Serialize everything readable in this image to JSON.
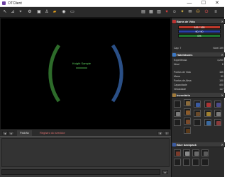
{
  "window": {
    "title": "OTClient",
    "min_glyph": "—",
    "max_glyph": "☐",
    "close_glyph": "✕"
  },
  "toolbar_left": [
    {
      "name": "arrow-icon",
      "glyph": "↖"
    },
    {
      "name": "logout-icon",
      "glyph": "⊿"
    },
    {
      "name": "hotkeys-icon",
      "glyph": "⌖"
    },
    {
      "name": "options-icon",
      "glyph": "⚙"
    },
    {
      "name": "minimap-icon",
      "glyph": "▣"
    },
    {
      "name": "outfit-icon",
      "glyph": "♙"
    },
    {
      "name": "folder-icon",
      "glyph": "▰"
    },
    {
      "name": "record-icon",
      "glyph": "◉"
    },
    {
      "name": "screenshot-icon",
      "glyph": "▭"
    }
  ],
  "toolbar_right": [
    {
      "name": "battle-list-icon",
      "glyph": "▤"
    },
    {
      "name": "skills-icon",
      "glyph": "▦"
    },
    {
      "name": "inventory-icon",
      "glyph": "▥"
    },
    {
      "name": "health-icon",
      "glyph": "♥"
    },
    {
      "name": "vip-icon",
      "glyph": "☺"
    },
    {
      "name": "spells-icon",
      "glyph": "✦"
    },
    {
      "name": "quest-icon",
      "glyph": "✉"
    },
    {
      "name": "shop-icon",
      "glyph": "⛁"
    },
    {
      "name": "power-icon",
      "glyph": "⏻"
    },
    {
      "name": "menu-icon",
      "glyph": "≡"
    }
  ],
  "game": {
    "player_name": "Knight Sample"
  },
  "console": {
    "tab_default": "Padrão",
    "tab_server_log": "Registro do servidor"
  },
  "health_panel": {
    "title": "Barra de Vida",
    "hp": "165 / 165",
    "mana": "90 / 90",
    "xp": "0%"
  },
  "capacity": {
    "cap_label": "Cap: 7",
    "level_label": "Nível 199"
  },
  "skills": {
    "title": "Habilidades",
    "rows": [
      {
        "label": "Experiência",
        "value": "4,200"
      },
      {
        "label": "Nível",
        "value": "8"
      },
      {
        "label": "Pontos de Vida",
        "value": "165"
      },
      {
        "label": "Mana",
        "value": "90"
      },
      {
        "label": "Pontos de Alma",
        "value": "100"
      },
      {
        "label": "Capacidade",
        "value": "400"
      },
      {
        "label": "Velocidade",
        "value": "117"
      }
    ]
  },
  "inventory": {
    "title": "Inventário"
  },
  "backpack": {
    "title": "Blue backpack"
  },
  "colors": {
    "hp_bar": "#c0392b",
    "mana_bar": "#2940a8",
    "xp_bar": "#1f7a2e",
    "arc_left": "#2d6b2a",
    "arc_right": "#2a4f86"
  }
}
